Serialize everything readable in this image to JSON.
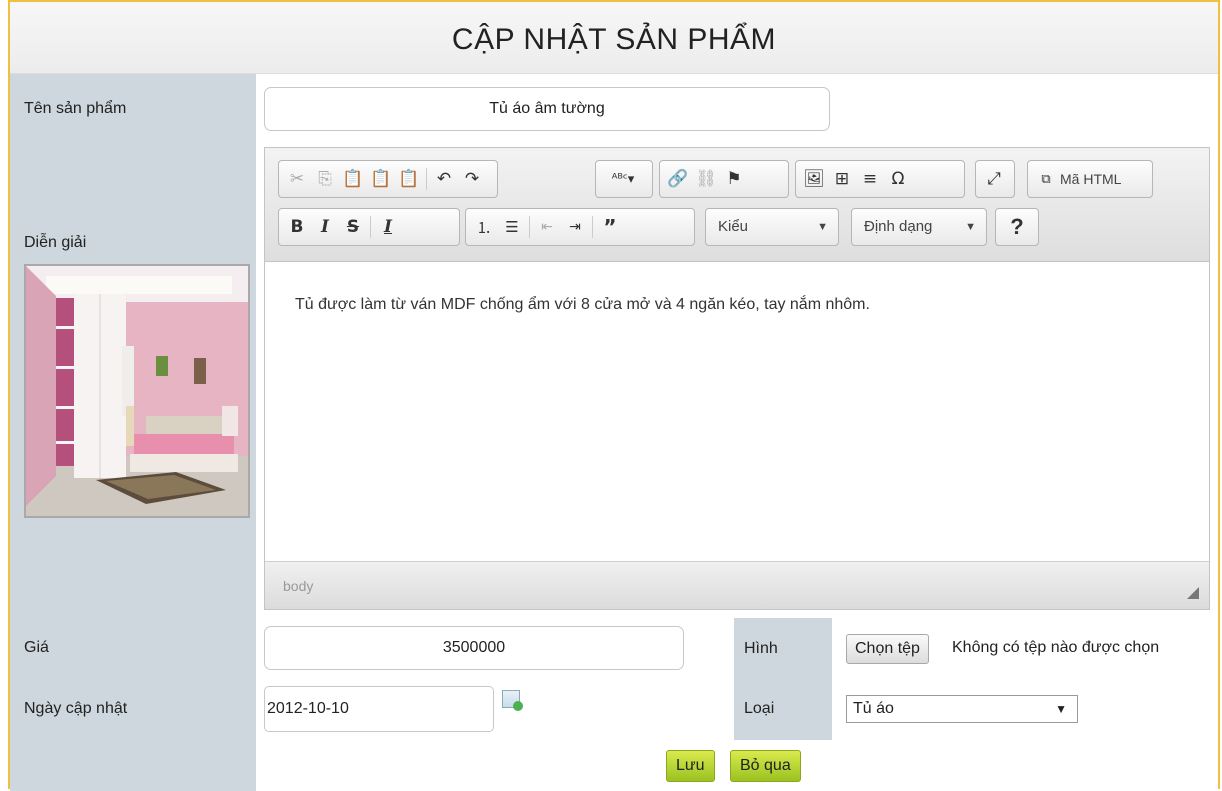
{
  "page": {
    "title": "CẬP NHẬT SẢN PHẨM"
  },
  "form": {
    "name_label": "Tên sản phẩm",
    "name_value": "Tủ áo âm tường",
    "description_label": "Diễn giải",
    "price_label": "Giá",
    "price_value": "3500000",
    "date_label": "Ngày cập nhật",
    "date_value": "2012-10-10",
    "image_label": "Hình",
    "file_button": "Chọn tệp",
    "file_status": "Không có tệp nào được chọn",
    "category_label": "Loại",
    "category_value": "Tủ áo",
    "save_button": "Lưu",
    "cancel_button": "Bỏ qua"
  },
  "editor": {
    "source_button": "Mã HTML",
    "styles_combo": "Kiểu",
    "format_combo": "Định dạng",
    "help_button": "?",
    "content": "Tủ được làm từ ván MDF chống ẩm với 8 cửa mở và 4 ngăn kéo, tay nắm nhôm.",
    "status_path": "body"
  },
  "colors": {
    "label_column": "#cdd7dd",
    "button_green": "#b4d62f",
    "frame_border": "#f0c040"
  }
}
